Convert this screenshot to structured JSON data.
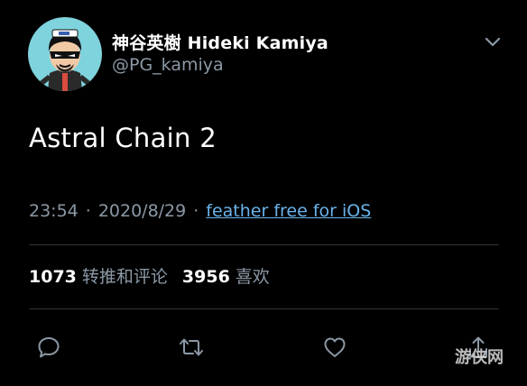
{
  "user": {
    "display_name": "神谷英樹 Hideki Kamiya",
    "handle": "@PG_kamiya"
  },
  "tweet": {
    "text": "Astral Chain 2",
    "time": "23:54",
    "separator": "·",
    "date": "2020/8/29",
    "source": "feather free for iOS"
  },
  "stats": {
    "retweets_count": "1073",
    "retweets_label": "转推和评论",
    "likes_count": "3956",
    "likes_label": "喜欢"
  },
  "watermark": "游侠网",
  "colors": {
    "background": "#000000",
    "text": "#ffffff",
    "secondary": "#8b98a5",
    "link": "#6ab3ea",
    "divider": "#2f3336",
    "avatar_bg": "#7fd3dc"
  },
  "icons": {
    "caret": "chevron-down-icon",
    "reply": "reply-icon",
    "retweet": "retweet-icon",
    "like": "heart-icon",
    "share": "share-icon"
  }
}
